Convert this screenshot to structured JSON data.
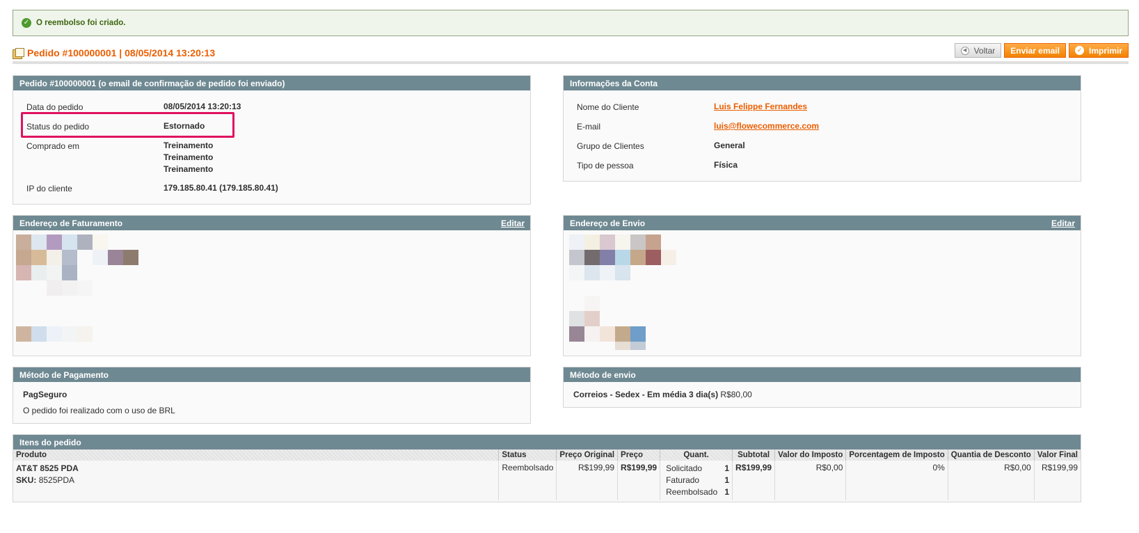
{
  "success_message": "O reembolso foi criado.",
  "header": {
    "title": "Pedido #100000001 | 08/05/2014 13:20:13",
    "buttons": {
      "back": "Voltar",
      "send_email": "Enviar email",
      "print": "Imprimir"
    }
  },
  "order": {
    "title": "Pedido #100000001 (o email de confirmação de pedido foi enviado)",
    "rows": [
      {
        "label": "Data do pedido",
        "value": "08/05/2014 13:20:13"
      },
      {
        "label": "Status do pedido",
        "value": "Estornado"
      },
      {
        "label": "Comprado em",
        "values": [
          "Treinamento",
          "Treinamento",
          "Treinamento"
        ]
      },
      {
        "label": "IP do cliente",
        "value": "179.185.80.41 (179.185.80.41)"
      }
    ]
  },
  "account": {
    "title": "Informações da Conta",
    "rows": [
      {
        "label": "Nome do Cliente",
        "value": "Luis Felippe Fernandes"
      },
      {
        "label": "E-mail",
        "value": "luis@flowecommerce.com"
      },
      {
        "label": "Grupo de Clientes",
        "value": "General"
      },
      {
        "label": "Tipo de pessoa",
        "value": "Física"
      }
    ]
  },
  "billing": {
    "title": "Endereço de Faturamento",
    "edit": "Editar"
  },
  "shipping_address": {
    "title": "Endereço de Envio",
    "edit": "Editar"
  },
  "payment": {
    "title": "Método de Pagamento",
    "method": "PagSeguro",
    "note": "O pedido foi realizado com o uso de BRL"
  },
  "shipping_method": {
    "title": "Método de envio",
    "method": "Correios - Sedex - Em média 3 dia(s)",
    "price": "R$80,00"
  },
  "items": {
    "title": "Itens do pedido",
    "columns": [
      "Produto",
      "Status",
      "Preço Original",
      "Preço",
      "Quant.",
      "Subtotal",
      "Valor do Imposto",
      "Porcentagem de Imposto",
      "Quantia de Desconto",
      "Valor Final"
    ],
    "row": {
      "product": "AT&T 8525 PDA",
      "sku_label": "SKU:",
      "sku": "8525PDA",
      "status": "Reembolsado",
      "original_price": "R$199,99",
      "price": "R$199,99",
      "qty": [
        {
          "label": "Solicitado",
          "value": "1"
        },
        {
          "label": "Faturado",
          "value": "1"
        },
        {
          "label": "Reembolsado",
          "value": "1"
        }
      ],
      "subtotal": "R$199,99",
      "tax_amount": "R$0,00",
      "tax_percent": "0%",
      "discount": "R$0,00",
      "row_total": "R$199,99"
    }
  },
  "colors": {
    "accent": "#eb5e00",
    "section_header": "#6f8992",
    "highlight": "#e0115f",
    "success_bg": "#eff5ea",
    "success_text": "#3d6611"
  }
}
